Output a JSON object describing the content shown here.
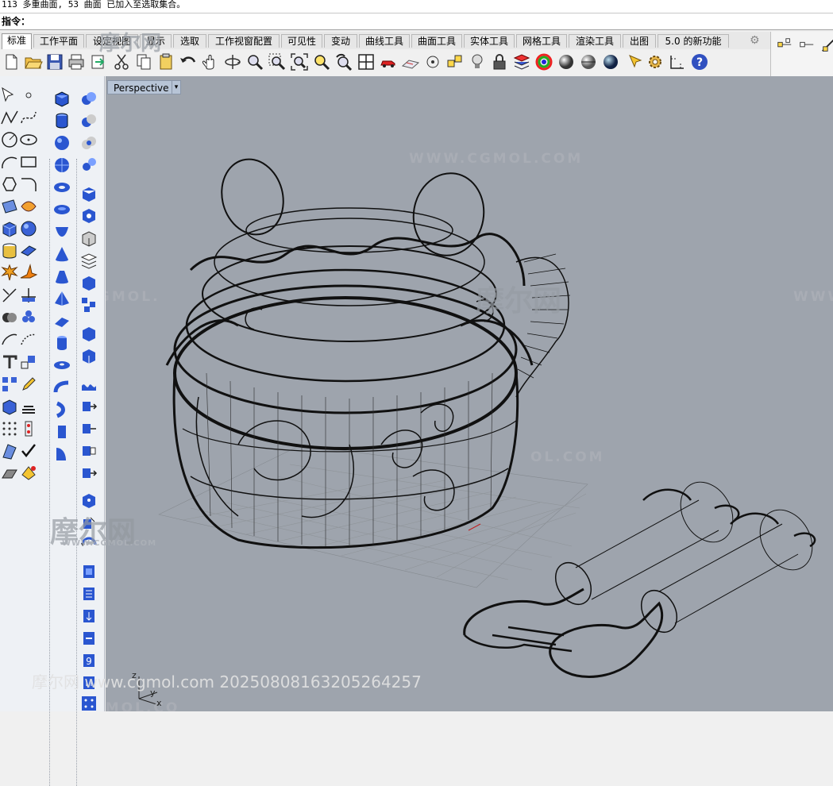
{
  "command": {
    "history": "113 多重曲面, 53 曲面 已加入至选取集合。",
    "prompt": "指令：",
    "input_value": ""
  },
  "tabs": [
    {
      "label": "标准",
      "active": true
    },
    {
      "label": "工作平面",
      "active": false
    },
    {
      "label": "设定视图",
      "active": false
    },
    {
      "label": "显示",
      "active": false
    },
    {
      "label": "选取",
      "active": false
    },
    {
      "label": "工作视窗配置",
      "active": false
    },
    {
      "label": "可见性",
      "active": false
    },
    {
      "label": "变动",
      "active": false
    },
    {
      "label": "曲线工具",
      "active": false
    },
    {
      "label": "曲面工具",
      "active": false
    },
    {
      "label": "实体工具",
      "active": false
    },
    {
      "label": "网格工具",
      "active": false
    },
    {
      "label": "渲染工具",
      "active": false
    },
    {
      "label": "出图",
      "active": false
    },
    {
      "label": "5.0 的新功能",
      "active": false
    }
  ],
  "toolbar_icons": [
    "new-file-icon",
    "open-file-icon",
    "save-icon",
    "print-icon",
    "import-icon",
    "cut-icon",
    "copy-icon",
    "paste-icon",
    "undo-icon",
    "pan-icon",
    "rotate-view-icon",
    "zoom-icon",
    "zoom-window-icon",
    "zoom-extents-icon",
    "zoom-selected-icon",
    "undo-view-icon",
    "four-viewports-icon",
    "car-icon",
    "cplane-icon",
    "point-icon",
    "select-points-icon",
    "light-icon",
    "lock-icon",
    "layer-icon",
    "color-icon",
    "sphere-shade-icon",
    "sphere-render-icon",
    "sphere-blue-icon",
    "paint-icon",
    "gear-icon",
    "dimension-icon",
    "help-icon"
  ],
  "viewport": {
    "title": "Perspective",
    "dropdown_symbol": "▾",
    "background": "#9ea4ad",
    "axis_labels": {
      "z": "z",
      "y": "y",
      "x": "x"
    }
  },
  "watermarks": {
    "site": "WWW.CGMOL.COM",
    "site_partial": "WWW.CGMOL.CO",
    "site_fragment": ".CGMOL.",
    "site_right": "WWW",
    "site_lower": "OL.COM",
    "logo_text": "摩尔网",
    "logo_small": "WWW.CGMOL.COM",
    "bottom": "摩尔网 www.cgmol.com 20250808163205264257"
  },
  "colors": {
    "tab_active": "#ffffff",
    "viewport_tab": "#b7c4d6",
    "wire": "#101010"
  }
}
